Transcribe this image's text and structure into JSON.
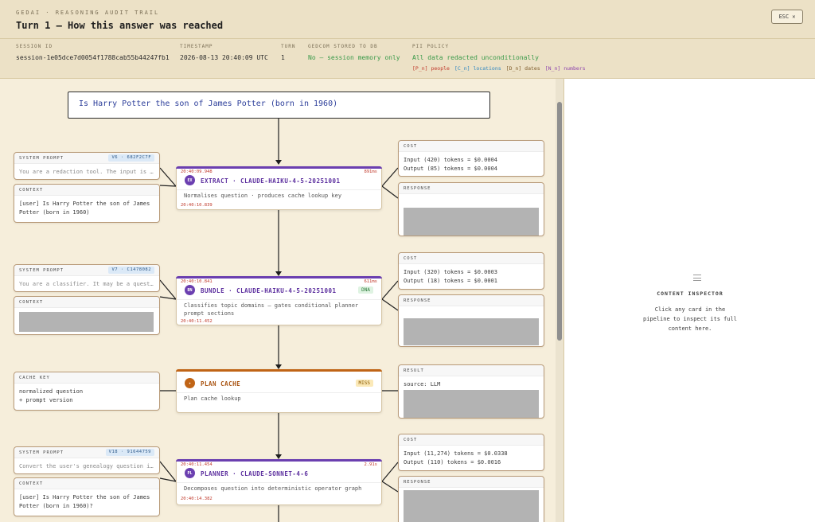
{
  "header": {
    "brand": "GEDAI · REASONING AUDIT TRAIL",
    "title": "Turn 1 — How this answer was reached",
    "esc_label": "ESC",
    "meta": [
      {
        "key": "SESSION ID",
        "value": "session-1e05dce7d0054f1788cab55b44247fb1"
      },
      {
        "key": "TIMESTAMP",
        "value": "2026-08-13 20:40:09 UTC"
      },
      {
        "key": "TURN",
        "value": "1"
      },
      {
        "key": "GEDCOM STORED TO DB",
        "value": "No — session memory only"
      },
      {
        "key": "PII POLICY",
        "value": "All data redacted unconditionally"
      }
    ],
    "legend": {
      "people": "[P_n] people",
      "locations": "[C_n] locations",
      "dates": "[D_n] dates",
      "numbers": "[N_n] numbers"
    }
  },
  "question": "Is Harry Potter the son of James Potter (born in 1960)",
  "stage1": {
    "system": {
      "label": "SYSTEM PROMPT",
      "badge": "V6 · 682F2C7F",
      "text": "You are a redaction tool. The input is a genealogy question"
    },
    "context": {
      "label": "CONTEXT",
      "text": "[user] Is Harry Potter the son of James Potter (born in 1960)"
    },
    "node": {
      "start": "20:40:09.948",
      "end": "20:40:10.839",
      "duration": "891ms",
      "abbr": "EX",
      "title": "EXTRACT · CLAUDE-HAIKU-4-5-20251001",
      "desc": "Normalises question · produces cache lookup key"
    },
    "cost": {
      "label": "COST",
      "input": "Input (420) tokens = $0.0004",
      "output": "Output (85) tokens = $0.0004"
    },
    "response": {
      "label": "RESPONSE"
    }
  },
  "stage2": {
    "system": {
      "label": "SYSTEM PROMPT",
      "badge": "V7 · C1478082",
      "text": "You are a classifier. It may be a question about"
    },
    "context": {
      "label": "CONTEXT"
    },
    "node": {
      "start": "20:40:10.841",
      "end": "20:40:11.452",
      "duration": "611ms",
      "abbr": "BN",
      "title": "BUNDLE · CLAUDE-HAIKU-4-5-20251001",
      "tag": "DNA",
      "desc": "Classifies topic domains — gates conditional planner prompt sections"
    },
    "cost": {
      "label": "COST",
      "input": "Input (320) tokens = $0.0003",
      "output": "Output (18) tokens = $0.0001"
    },
    "response": {
      "label": "RESPONSE"
    }
  },
  "stage3": {
    "key": {
      "label": "CACHE KEY",
      "line1": "normalized question",
      "line2": "+ prompt version"
    },
    "node": {
      "title": "PLAN CACHE",
      "tag": "MISS",
      "desc": "Plan cache lookup"
    },
    "result": {
      "label": "RESULT",
      "text": "source: LLM"
    }
  },
  "stage4": {
    "system": {
      "label": "SYSTEM PROMPT",
      "badge": "V18 · 91644759",
      "text": "Convert the user's genealogy question into a plan"
    },
    "context": {
      "label": "CONTEXT",
      "text": "[user] Is Harry Potter the son of James Potter (born in 1960)?"
    },
    "node": {
      "start": "20:40:11.454",
      "end": "20:40:14.382",
      "duration": "2.91s",
      "abbr": "PL",
      "title": "PLANNER · CLAUDE-SONNET-4-6",
      "desc": "Decomposes question into deterministic operator graph"
    },
    "cost": {
      "label": "COST",
      "input": "Input (11,274) tokens = $0.0338",
      "output": "Output (110) tokens = $0.0016"
    },
    "response": {
      "label": "RESPONSE"
    }
  },
  "inspector": {
    "title": "CONTENT INSPECTOR",
    "body": "Click any card in the pipeline to inspect its full content here."
  }
}
